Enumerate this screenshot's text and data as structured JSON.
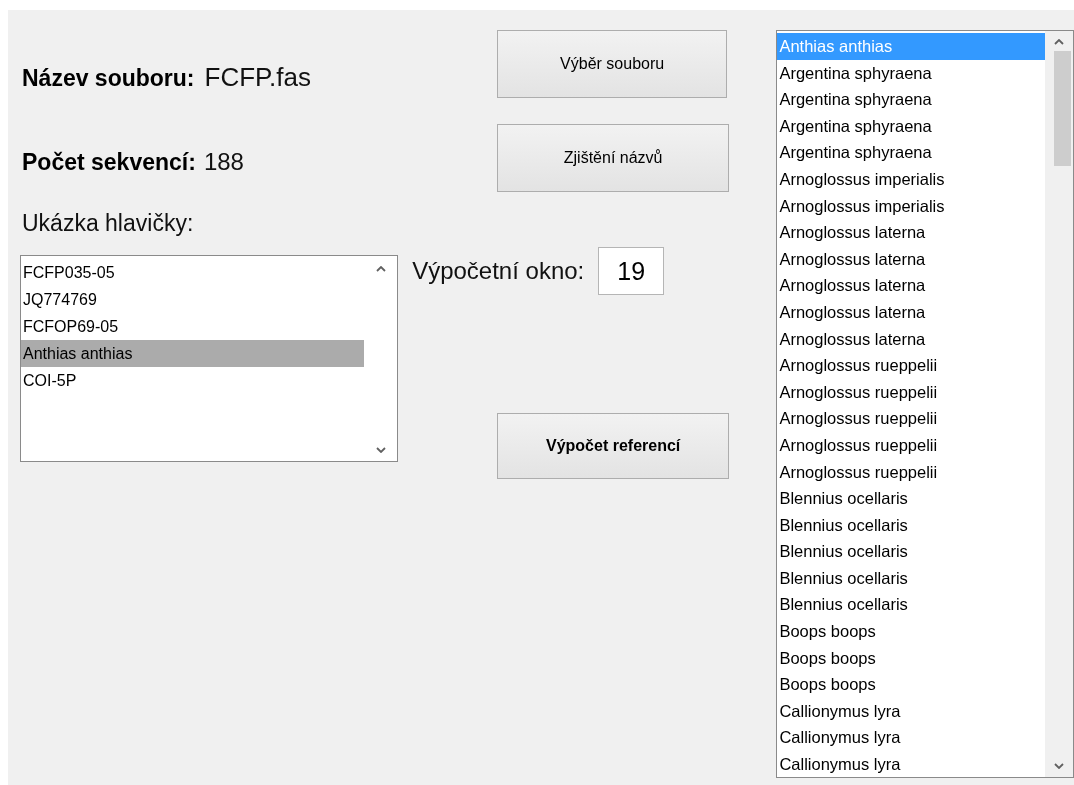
{
  "file_name": {
    "label": "Název souboru:",
    "value": "FCFP.fas"
  },
  "sequence_count": {
    "label": "Počet sekvencí:",
    "value": "188"
  },
  "header_preview": {
    "label": "Ukázka hlavičky:",
    "items": [
      {
        "text": "FCFP035-05",
        "selected": false
      },
      {
        "text": "JQ774769",
        "selected": false
      },
      {
        "text": "FCFOP69-05",
        "selected": false
      },
      {
        "text": "Anthias anthias",
        "selected": true
      },
      {
        "text": "COI-5P",
        "selected": false
      }
    ]
  },
  "buttons": [
    {
      "label": "Výběr souboru",
      "bold": false
    },
    {
      "label": "Zjištění názvů",
      "bold": false
    }
  ],
  "window_field": {
    "label": "Výpočetní okno:",
    "value": "19"
  },
  "compute_button": {
    "label": "Výpočet referencí",
    "bold": true
  },
  "species_list": {
    "items": [
      {
        "text": "Anthias anthias",
        "selected": true
      },
      {
        "text": "Argentina sphyraena",
        "selected": false
      },
      {
        "text": "Argentina sphyraena",
        "selected": false
      },
      {
        "text": "Argentina sphyraena",
        "selected": false
      },
      {
        "text": "Argentina sphyraena",
        "selected": false
      },
      {
        "text": "Arnoglossus imperialis",
        "selected": false
      },
      {
        "text": "Arnoglossus imperialis",
        "selected": false
      },
      {
        "text": "Arnoglossus laterna",
        "selected": false
      },
      {
        "text": "Arnoglossus laterna",
        "selected": false
      },
      {
        "text": "Arnoglossus laterna",
        "selected": false
      },
      {
        "text": "Arnoglossus laterna",
        "selected": false
      },
      {
        "text": "Arnoglossus laterna",
        "selected": false
      },
      {
        "text": "Arnoglossus rueppelii",
        "selected": false
      },
      {
        "text": "Arnoglossus rueppelii",
        "selected": false
      },
      {
        "text": "Arnoglossus rueppelii",
        "selected": false
      },
      {
        "text": "Arnoglossus rueppelii",
        "selected": false
      },
      {
        "text": "Arnoglossus rueppelii",
        "selected": false
      },
      {
        "text": "Blennius ocellaris",
        "selected": false
      },
      {
        "text": "Blennius ocellaris",
        "selected": false
      },
      {
        "text": "Blennius ocellaris",
        "selected": false
      },
      {
        "text": "Blennius ocellaris",
        "selected": false
      },
      {
        "text": "Blennius ocellaris",
        "selected": false
      },
      {
        "text": "Boops boops",
        "selected": false
      },
      {
        "text": "Boops boops",
        "selected": false
      },
      {
        "text": "Boops boops",
        "selected": false
      },
      {
        "text": "Callionymus lyra",
        "selected": false
      },
      {
        "text": "Callionymus lyra",
        "selected": false
      },
      {
        "text": "Callionymus lyra",
        "selected": false
      }
    ]
  }
}
